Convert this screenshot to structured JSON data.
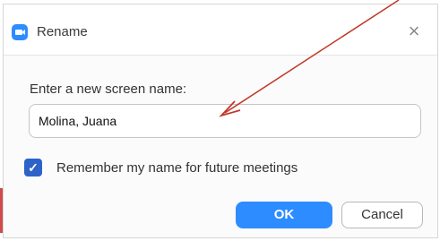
{
  "dialog": {
    "title": "Rename",
    "close_symbol": "×",
    "prompt_label": "Enter a new screen name:",
    "name_value": "Molina, Juana",
    "remember_checked": true,
    "remember_label": "Remember my name for future meetings",
    "ok_label": "OK",
    "cancel_label": "Cancel"
  },
  "icons": {
    "app": "zoom-camera-icon",
    "close": "close-icon",
    "check": "checkmark-icon"
  },
  "colors": {
    "accent": "#2d8cff",
    "checkbox": "#2d63c8",
    "annotation_arrow": "#c0392b"
  }
}
